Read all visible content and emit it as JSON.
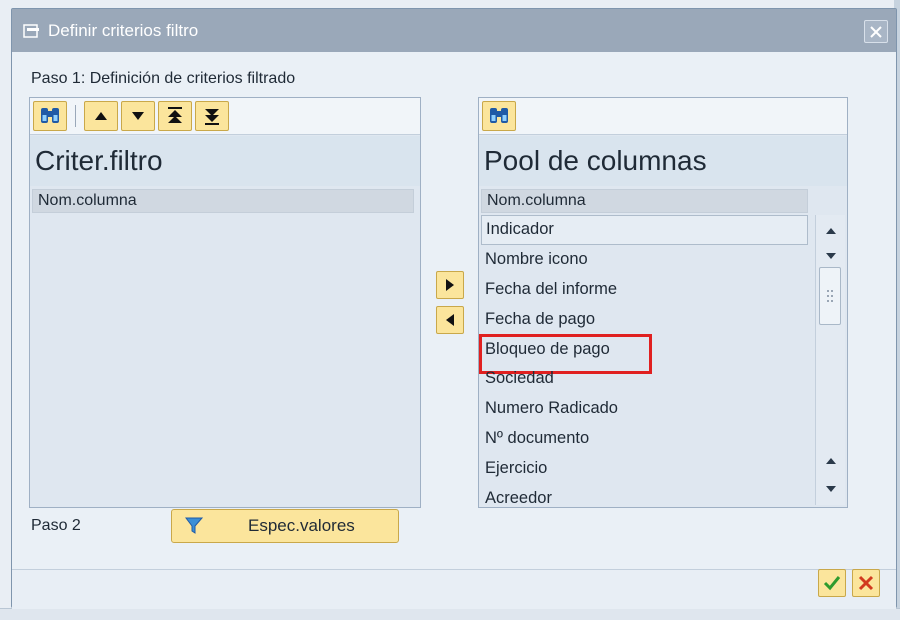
{
  "dialog": {
    "title": "Definir criterios filtro",
    "step1_label": "Paso 1: Definición de criterios filtrado",
    "step2_label": "Paso 2",
    "spec_button_label": "Espec.valores"
  },
  "left_panel": {
    "header": "Criter.filtro",
    "column_header": "Nom.columna",
    "items": []
  },
  "right_panel": {
    "header": "Pool de columnas",
    "column_header": "Nom.columna",
    "items": [
      "Indicador",
      "Nombre icono",
      "Fecha del informe",
      "Fecha de pago",
      "Bloqueo de pago",
      "Sociedad",
      "Numero Radicado",
      "Nº documento",
      "Ejercicio",
      "Acreedor"
    ],
    "selected_item": "Indicador",
    "highlighted_item": "Bloqueo de pago"
  },
  "icons": {
    "title": "window-icon",
    "find": "binoculars-icon",
    "move_up": "arrow-up-icon",
    "move_down": "arrow-down-icon",
    "move_top": "arrow-top-icon",
    "move_bottom": "arrow-bottom-icon",
    "add": "arrow-right-icon",
    "remove": "arrow-left-icon",
    "filter": "filter-icon",
    "ok": "checkmark-icon",
    "cancel": "cancel-icon"
  },
  "colors": {
    "title_bar": "#9aa8b9",
    "button_yellow": "#fbe59c",
    "highlight_box": "#e02020",
    "ok_green": "#2e9b2e",
    "cancel_red": "#d23a1f"
  }
}
